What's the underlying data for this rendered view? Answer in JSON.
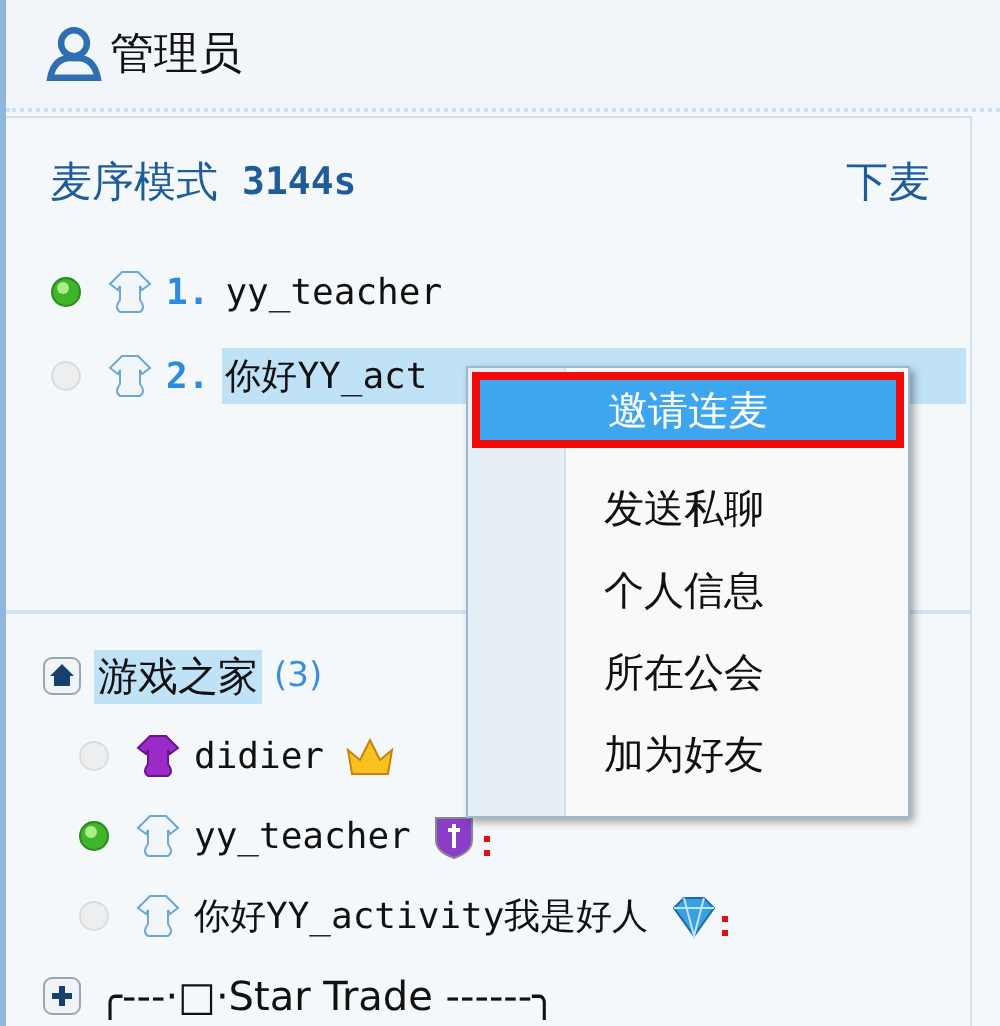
{
  "header": {
    "title": "管理员"
  },
  "mic_queue": {
    "mode_label": "麦序模式",
    "timer": "3144s",
    "action": "下麦",
    "members": [
      {
        "number": "1.",
        "name": "yy_teacher",
        "online": true,
        "selected": false
      },
      {
        "number": "2.",
        "name": "你好YY_act",
        "online": false,
        "selected": true
      }
    ]
  },
  "context_menu": {
    "items": [
      {
        "label": "邀请连麦",
        "selected": true
      },
      {
        "label": "发送私聊",
        "selected": false
      },
      {
        "label": "个人信息",
        "selected": false
      },
      {
        "label": "所在公会",
        "selected": false
      },
      {
        "label": "加为好友",
        "selected": false
      }
    ]
  },
  "channels": [
    {
      "name": "游戏之家",
      "count": "(3)",
      "expanded": true,
      "selected": true,
      "children": [
        {
          "kind": "vip",
          "name": "didier",
          "online": false,
          "badge": {
            "kind": "crown"
          }
        },
        {
          "kind": "member",
          "name": "yy_teacher",
          "online": true,
          "badge": {
            "kind": "shield"
          }
        },
        {
          "kind": "member",
          "name": "你好YY_activity我是好人",
          "online": false,
          "badge": {
            "kind": "diamond"
          }
        }
      ]
    },
    {
      "name": "╭---·□·Star Trade ------╮",
      "expanded": false,
      "selected": false
    }
  ]
}
